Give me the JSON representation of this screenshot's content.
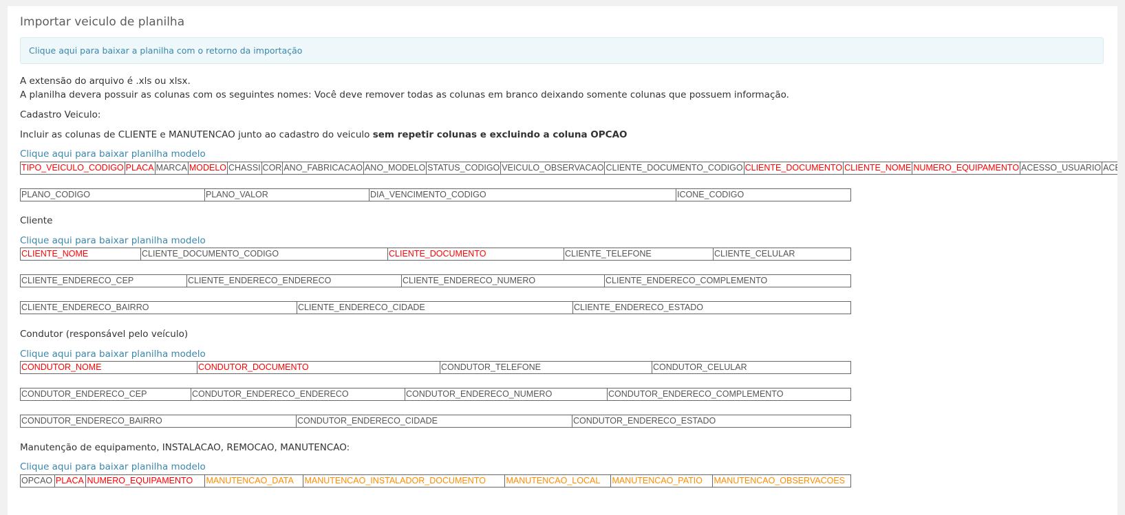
{
  "page": {
    "title": "Importar veiculo de planilha",
    "alert_link": "Clique aqui para baixar a planilha com o retorno da importação"
  },
  "intro": {
    "line1": "A extensão do arquivo é .xls ou xlsx.",
    "line2": "A planilha devera possuir as colunas com os seguintes nomes: Você deve remover todas as colunas em branco deixando somente colunas que possuem informação.",
    "cadastro_label": "Cadastro Veiculo:",
    "include_prefix": "Incluir as colunas de CLIENTE e MANUTENCAO junto ao cadastro do veiculo ",
    "include_bold": "sem repetir colunas e excluindo a coluna OPCAO"
  },
  "colors": {
    "required": "#ff0000",
    "maintenance": "#ff8c00",
    "link": "#3a87ad"
  },
  "veiculo": {
    "download_link": "Clique aqui para baixar planilha modelo",
    "row1": [
      "TIPO_VEICULO_CODIGO",
      "PLACA",
      "MARCA",
      "MODELO",
      "CHASSI",
      "COR",
      "ANO_FABRICACAO",
      "ANO_MODELO",
      "STATUS_CODIGO",
      "VEICULO_OBSERVACAO",
      "CLIENTE_DOCUMENTO_CODIGO",
      "CLIENTE_DOCUMENTO",
      "CLIENTE_NOME",
      "NUMERO_EQUIPAMENTO",
      "ACESSO_USUARIO",
      "ACESSO_SENHA"
    ],
    "row2": [
      "PLANO_CODIGO",
      "PLANO_VALOR",
      "DIA_VENCIMENTO_CODIGO",
      "ICONE_CODIGO"
    ]
  },
  "cliente": {
    "label": "Cliente",
    "download_link": "Clique aqui para baixar planilha modelo",
    "row1": [
      "CLIENTE_NOME",
      "CLIENTE_DOCUMENTO_CODIGO",
      "CLIENTE_DOCUMENTO",
      "CLIENTE_TELEFONE",
      "CLIENTE_CELULAR"
    ],
    "row2": [
      "CLIENTE_ENDERECO_CEP",
      "CLIENTE_ENDERECO_ENDERECO",
      "CLIENTE_ENDERECO_NUMERO",
      "CLIENTE_ENDERECO_COMPLEMENTO"
    ],
    "row3": [
      "CLIENTE_ENDERECO_BAIRRO",
      "CLIENTE_ENDERECO_CIDADE",
      "CLIENTE_ENDERECO_ESTADO"
    ]
  },
  "condutor": {
    "label": "Condutor (responsável pelo veículo)",
    "download_link": "Clique aqui para baixar planilha modelo",
    "row1": [
      "CONDUTOR_NOME",
      "CONDUTOR_DOCUMENTO",
      "CONDUTOR_TELEFONE",
      "CONDUTOR_CELULAR"
    ],
    "row2": [
      "CONDUTOR_ENDERECO_CEP",
      "CONDUTOR_ENDERECO_ENDERECO",
      "CONDUTOR_ENDERECO_NUMERO",
      "CONDUTOR_ENDERECO_COMPLEMENTO"
    ],
    "row3": [
      "CONDUTOR_ENDERECO_BAIRRO",
      "CONDUTOR_ENDERECO_CIDADE",
      "CONDUTOR_ENDERECO_ESTADO"
    ]
  },
  "manutencao": {
    "label": "Manutenção de equipamento, INSTALACAO, REMOCAO, MANUTENCAO:",
    "download_link": "Clique aqui para baixar planilha modelo",
    "row1": [
      "OPCAO",
      "PLACA",
      "NUMERO_EQUIPAMENTO",
      "MANUTENCAO_DATA",
      "MANUTENCAO_INSTALADOR_DOCUMENTO",
      "MANUTENCAO_LOCAL",
      "MANUTENCAO_PATIO",
      "MANUTENCAO_OBSERVACOES"
    ]
  }
}
